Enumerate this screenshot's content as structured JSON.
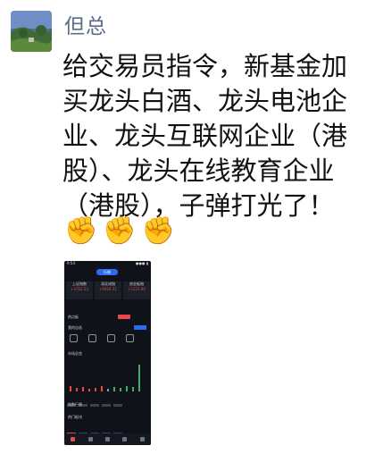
{
  "chat": {
    "sender_name": "但总",
    "message_lines": [
      "给交易员指令，新基金加",
      "买龙头白酒、龙头电池企",
      "业、龙头互联网企业（港",
      "股）、龙头在线教育企业",
      "（港股），子弹打光了！"
    ],
    "emojis": [
      "✊",
      "✊",
      "✊"
    ]
  },
  "phone": {
    "status_time": "9:54",
    "status_right": "●●● ▮",
    "tab_label": "行情",
    "indices": [
      {
        "name": "上证指数",
        "value": "+3762.53"
      },
      {
        "name": "深证成指",
        "value": "+9916.31"
      },
      {
        "name": "创业板指",
        "value": "+3123.80"
      }
    ],
    "section_labels": [
      "热点板",
      "我的自选",
      "市场总览",
      "指数行情",
      "热门板块"
    ]
  }
}
